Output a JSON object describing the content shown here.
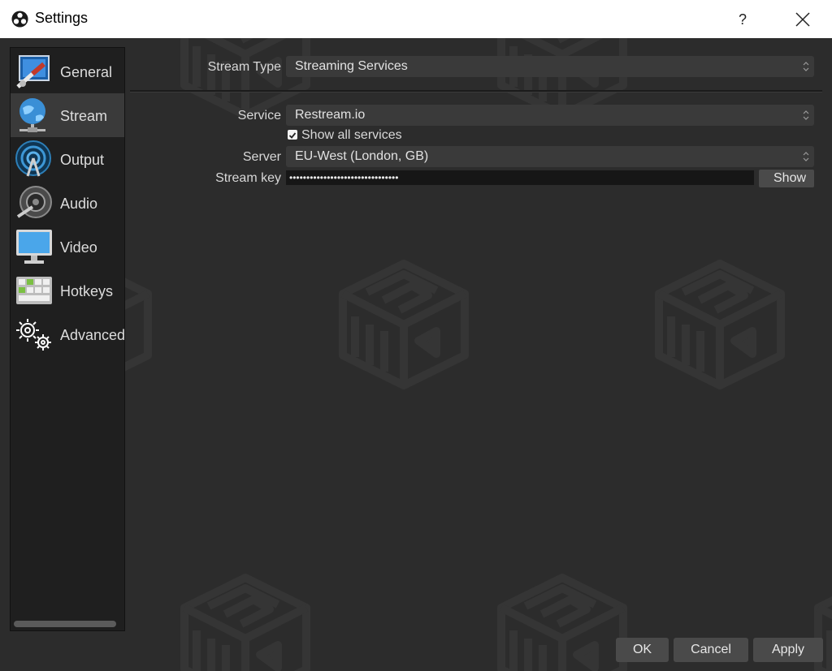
{
  "window": {
    "title": "Settings",
    "help_label": "?",
    "app_icon": "obs-logo-icon",
    "close_icon": "close-icon"
  },
  "sidebar": {
    "items": [
      {
        "label": "General",
        "icon": "general-settings-icon",
        "active": false
      },
      {
        "label": "Stream",
        "icon": "stream-globe-icon",
        "active": true
      },
      {
        "label": "Output",
        "icon": "output-broadcast-icon",
        "active": false
      },
      {
        "label": "Audio",
        "icon": "audio-speaker-icon",
        "active": false
      },
      {
        "label": "Video",
        "icon": "video-monitor-icon",
        "active": false
      },
      {
        "label": "Hotkeys",
        "icon": "hotkeys-keyboard-icon",
        "active": false
      },
      {
        "label": "Advanced",
        "icon": "advanced-gears-icon",
        "active": false
      }
    ]
  },
  "stream": {
    "stream_type_label": "Stream Type",
    "stream_type_value": "Streaming Services",
    "service_label": "Service",
    "service_value": "Restream.io",
    "show_all_label": "Show all services",
    "show_all_checked": true,
    "server_label": "Server",
    "server_value": "EU-West (London, GB)",
    "stream_key_label": "Stream key",
    "stream_key_value": "••••••••••••••••••••••••••••••••",
    "show_button_label": "Show"
  },
  "buttons": {
    "ok": "OK",
    "cancel": "Cancel",
    "apply": "Apply"
  },
  "colors": {
    "background": "#2c2c2c",
    "sidebar": "#1f1f1f",
    "active_item": "#3a3a3a",
    "combo": "#3a3a3a",
    "button": "#4a4a4a"
  }
}
